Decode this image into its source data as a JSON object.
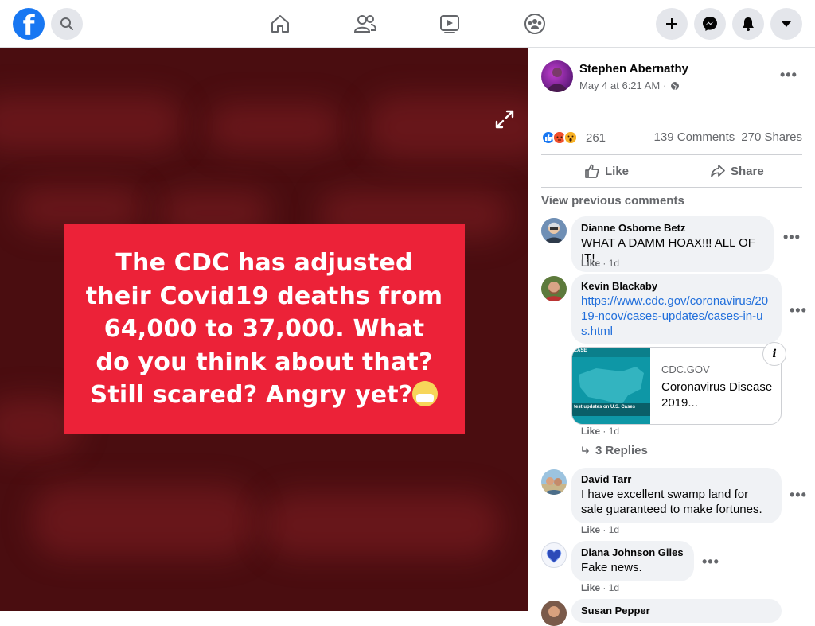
{
  "topbar": {
    "logo": "f",
    "icons": [
      "facebook-logo",
      "search-icon",
      "home-icon",
      "friends-icon",
      "watch-icon",
      "groups-icon",
      "plus-icon",
      "messenger-icon",
      "notifications-icon",
      "account-menu-icon"
    ]
  },
  "viewer": {
    "meme_lines": [
      "The CDC has adjusted",
      "their Covid19 deaths from",
      "64,000 to 37,000.  What",
      "do you think about that?",
      "Still scared? Angry yet?"
    ],
    "colors": {
      "meme_bg": "#ec2238",
      "viewer_bg": "#4a0d10"
    }
  },
  "post": {
    "author": "Stephen Abernathy",
    "time": "May 4 at 6:21 AM",
    "privacy_separator": "·",
    "reaction_count": "261",
    "comments_count": "139 Comments",
    "shares_count": "270 Shares",
    "like_label": "Like",
    "share_label": "Share"
  },
  "comments": {
    "view_previous": "View previous comments",
    "items": [
      {
        "name": "Dianne Osborne Betz",
        "text": "WHAT A DAMM HOAX!!! ALL OF IT!",
        "like": "Like",
        "age": "1d"
      },
      {
        "name": "Kevin Blackaby",
        "link": "https://www.cdc.gov/coronavirus/2019-ncov/cases-updates/cases-in-us.html",
        "like": "Like",
        "age": "1d",
        "card": {
          "domain": "CDC.GOV",
          "title": "Coronavirus Disease 2019...",
          "thumb_caption": "test updates on U.S. Cases",
          "thumb_tag": "EASE"
        },
        "replies": "3 Replies"
      },
      {
        "name": "David Tarr",
        "text": "I have excellent swamp land for sale guaranteed to make fortunes.",
        "like": "Like",
        "age": "1d"
      },
      {
        "name": "Diana Johnson Giles",
        "text": "Fake news.",
        "like": "Like",
        "age": "1d"
      },
      {
        "name": "Susan Pepper"
      }
    ]
  },
  "colors": {
    "brand": "#1877f2",
    "link": "#216fdb",
    "secondary_text": "#65676b",
    "bubble": "#f0f2f5"
  }
}
